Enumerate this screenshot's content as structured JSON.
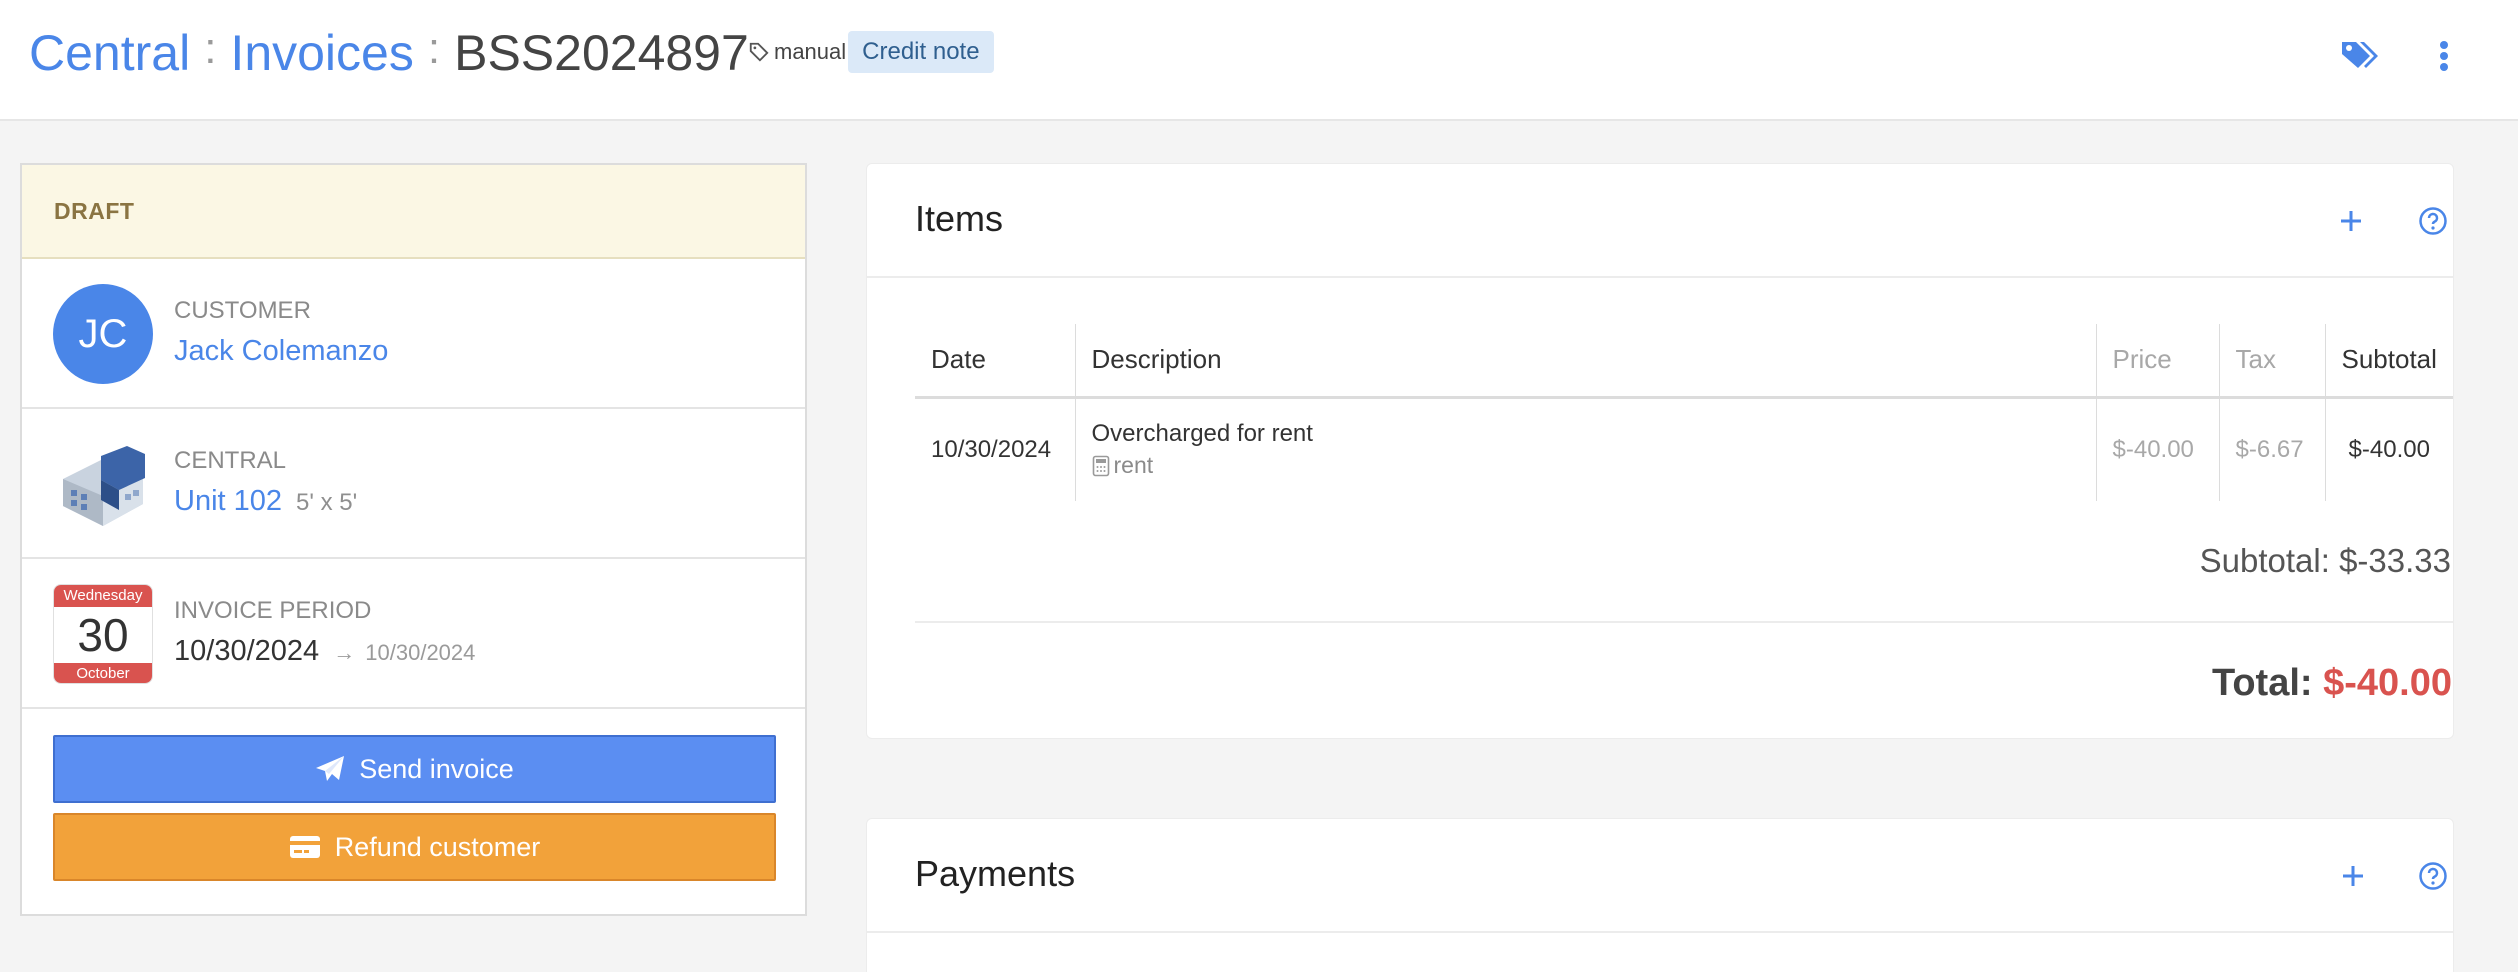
{
  "header": {
    "crumbs": [
      "Central",
      "Invoices"
    ],
    "separator": ":",
    "current": "BSS2024897",
    "tag_label": "manual",
    "badge": "Credit note"
  },
  "left": {
    "status": "DRAFT",
    "customer": {
      "label": "CUSTOMER",
      "initials": "JC",
      "name": "Jack Colemanzo"
    },
    "unit": {
      "label": "CENTRAL",
      "name": "Unit 102",
      "size": "5' x 5'"
    },
    "period": {
      "label": "INVOICE PERIOD",
      "cal_weekday": "Wednesday",
      "cal_day": "30",
      "cal_month": "October",
      "start": "10/30/2024",
      "arrow": "→",
      "end": "10/30/2024"
    },
    "buttons": {
      "send": "Send invoice",
      "refund": "Refund customer"
    }
  },
  "items": {
    "title": "Items",
    "columns": [
      "Date",
      "Description",
      "Price",
      "Tax",
      "Subtotal"
    ],
    "rows": [
      {
        "date": "10/30/2024",
        "description": "Overcharged for rent",
        "category": "rent",
        "price": "$-40.00",
        "tax": "$-6.67",
        "subtotal": "$-40.00"
      }
    ],
    "subtotal_label": "Subtotal: $-33.33",
    "total_label": "Total:",
    "total_value": "$-40.00"
  },
  "payments": {
    "title": "Payments"
  },
  "colors": {
    "accent": "#4a86e8",
    "send": "#5b8ef2",
    "refund": "#f2a23a",
    "negative": "#d9534f",
    "draft_bg": "#fbf7e4"
  },
  "icons": [
    "tag-icon",
    "tags-icon",
    "more-vertical-icon",
    "plus-icon",
    "help-icon",
    "paper-plane-icon",
    "credit-card-icon",
    "building-icon",
    "calendar-icon",
    "calculator-icon"
  ]
}
